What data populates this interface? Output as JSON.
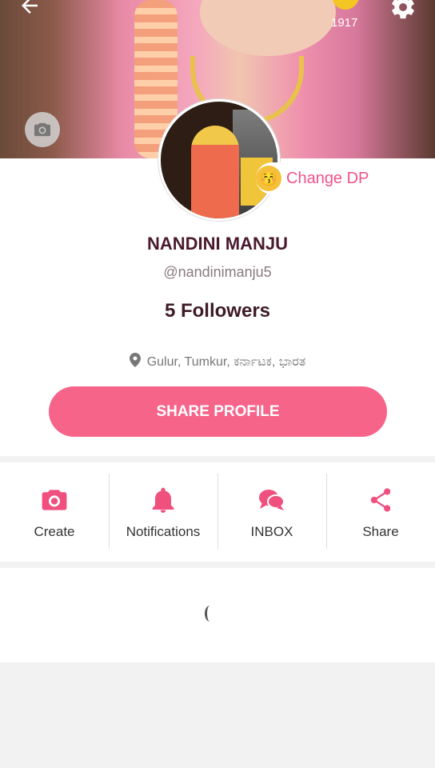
{
  "header": {
    "coin_count": "1917"
  },
  "profile": {
    "change_dp_label": "Change DP",
    "name": "NANDINI MANJU",
    "handle": "@nandinimanju5",
    "followers": "5 Followers",
    "location": "Gulur, Tumkur, ಕರ್ನಾಟಕ, ಭಾರತ",
    "share_label": "SHARE PROFILE"
  },
  "actions": [
    {
      "label": "Create",
      "icon": "camera-icon"
    },
    {
      "label": "Notifications",
      "icon": "bell-icon"
    },
    {
      "label": "INBOX",
      "icon": "chat-icon"
    },
    {
      "label": "Share",
      "icon": "share-icon"
    }
  ],
  "colors": {
    "accent": "#f6648a",
    "name": "#4a1a2c"
  }
}
